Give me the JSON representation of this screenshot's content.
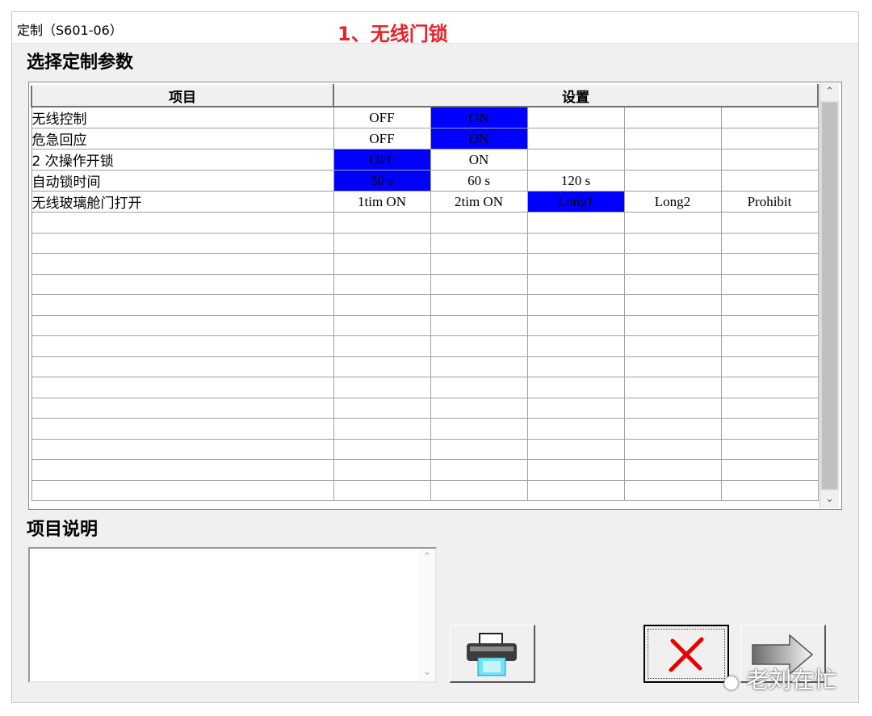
{
  "window": {
    "title": "定制（S601-06）"
  },
  "overlay_caption": "1、无线门锁",
  "section_params_title": "选择定制参数",
  "section_desc_title": "项目说明",
  "grid": {
    "headers": {
      "item": "项目",
      "setting": "设置"
    },
    "rows": [
      {
        "name": "无线控制",
        "options": [
          "OFF",
          "ON",
          "",
          "",
          ""
        ],
        "selected": 1
      },
      {
        "name": "危急回应",
        "options": [
          "OFF",
          "ON",
          "",
          "",
          ""
        ],
        "selected": 1
      },
      {
        "name": "2 次操作开锁",
        "options": [
          "OFF",
          "ON",
          "",
          "",
          ""
        ],
        "selected": 0
      },
      {
        "name": "自动锁时间",
        "options": [
          "30 s",
          "60 s",
          "120 s",
          "",
          ""
        ],
        "selected": 0
      },
      {
        "name": "无线玻璃舱门打开",
        "options": [
          "1tim ON",
          "2tim ON",
          "Long1",
          "Long2",
          "Prohibit"
        ],
        "selected": 2
      }
    ],
    "empty_rows": 14
  },
  "description": {
    "text": ""
  },
  "buttons": {
    "print": "printer-icon",
    "cancel": "close-x-icon",
    "next": "arrow-right-icon"
  },
  "watermark": "老刘在忙",
  "colors": {
    "selected_bg": "#0000ff",
    "selected_fg": "#ffffff",
    "caption": "#e8242a"
  }
}
